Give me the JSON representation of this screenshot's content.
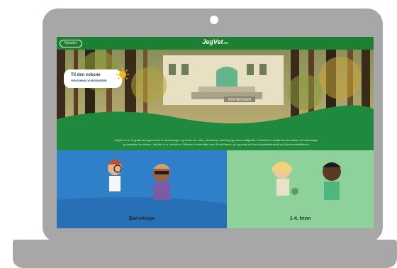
{
  "window": {
    "brand": "JegVet",
    "brand_suffix": ".no",
    "top_button": "Nyheter"
  },
  "hero": {
    "callout_title": "Til den voksne",
    "callout_subtitle": "VEILEDNING OG RESSURSER",
    "signboard": "BOKSKOGEN",
    "info_text": "JegVet.no er et gratis læringsressurs for barnehager og skoler om natur, vennskap, mestring og barns rettigheter. Innholdet er knyttet til rammeplan for barnehager og læreplan for skolen. JegVet.no er utviklet av Stiftelsen Lærerløftet med Redd Barna, på oppdrag fra Norsk Lysbildefestival og Sparebankstiftelsen."
  },
  "panels": [
    {
      "label": "Barnehage",
      "color": "#2f7fc9"
    },
    {
      "label": "1-4. trinn",
      "color": "#8fd19b"
    }
  ]
}
